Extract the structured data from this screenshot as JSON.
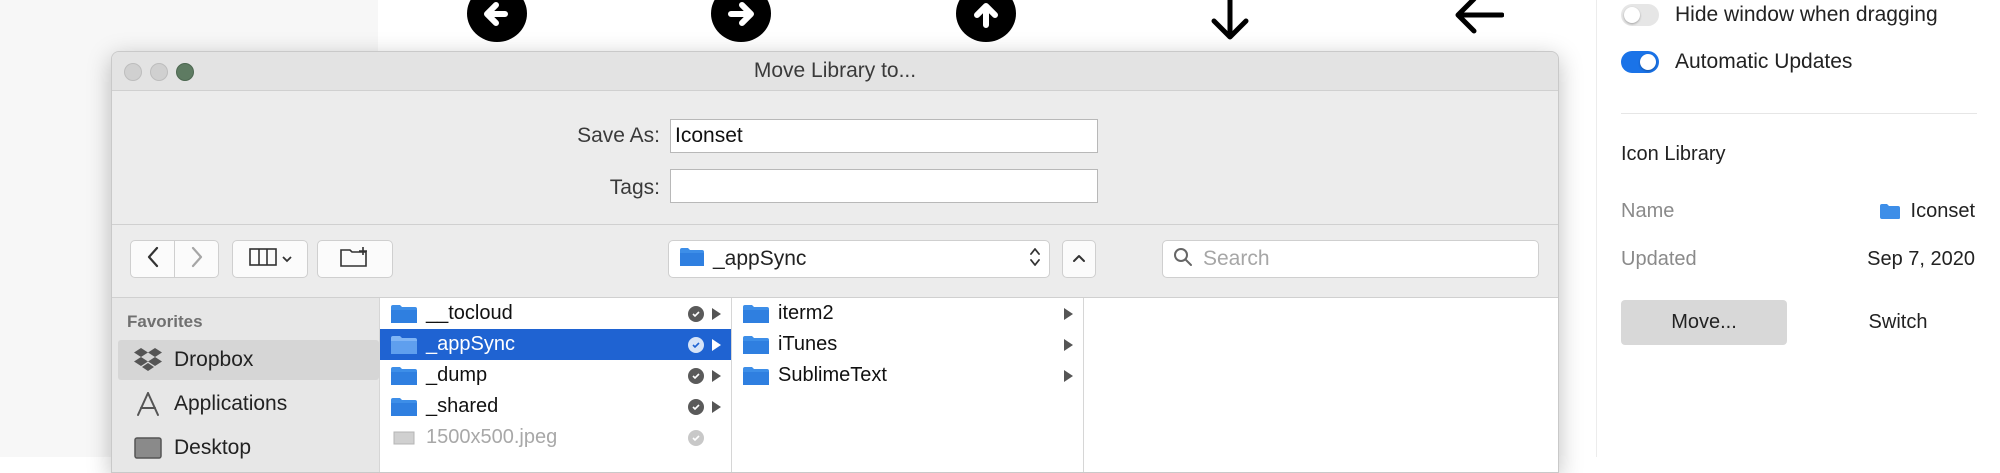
{
  "background": {
    "icon_names": [
      "arrow-left-circle-icon",
      "arrow-right-circle-icon",
      "arrow-up-circle-icon",
      "arrow-down-icon",
      "arrow-left-icon"
    ]
  },
  "settings": {
    "hide_window_label": "Hide window when dragging",
    "hide_window_on": false,
    "auto_updates_label": "Automatic Updates",
    "auto_updates_on": true,
    "section_title": "Icon Library",
    "name_key": "Name",
    "name_value": "Iconset",
    "updated_key": "Updated",
    "updated_value": "Sep 7, 2020",
    "move_button": "Move...",
    "switch_button": "Switch"
  },
  "dialog": {
    "title": "Move Library to...",
    "save_as_label": "Save As:",
    "save_as_value": "Iconset",
    "tags_label": "Tags:",
    "tags_value": "",
    "location": "_appSync",
    "search_placeholder": "Search",
    "favorites_heading": "Favorites",
    "sidebar_items": [
      {
        "label": "Dropbox",
        "icon": "dropbox-icon",
        "selected": true
      },
      {
        "label": "Applications",
        "icon": "applications-icon",
        "selected": false
      },
      {
        "label": "Desktop",
        "icon": "desktop-icon",
        "selected": false
      }
    ],
    "column1": [
      {
        "label": "__tocloud",
        "synced": true,
        "folder": true,
        "selected": false,
        "dim": false
      },
      {
        "label": "_appSync",
        "synced": true,
        "folder": true,
        "selected": true,
        "dim": false
      },
      {
        "label": "_dump",
        "synced": true,
        "folder": true,
        "selected": false,
        "dim": false
      },
      {
        "label": "_shared",
        "synced": true,
        "folder": true,
        "selected": false,
        "dim": false
      },
      {
        "label": "1500x500.jpeg",
        "synced": true,
        "folder": false,
        "selected": false,
        "dim": true
      }
    ],
    "column2": [
      {
        "label": "iterm2"
      },
      {
        "label": "iTunes"
      },
      {
        "label": "SublimeText"
      }
    ]
  },
  "colors": {
    "accent": "#1f63d2",
    "toggle_on": "#1a73e8",
    "folder": "#3d8ee8"
  }
}
